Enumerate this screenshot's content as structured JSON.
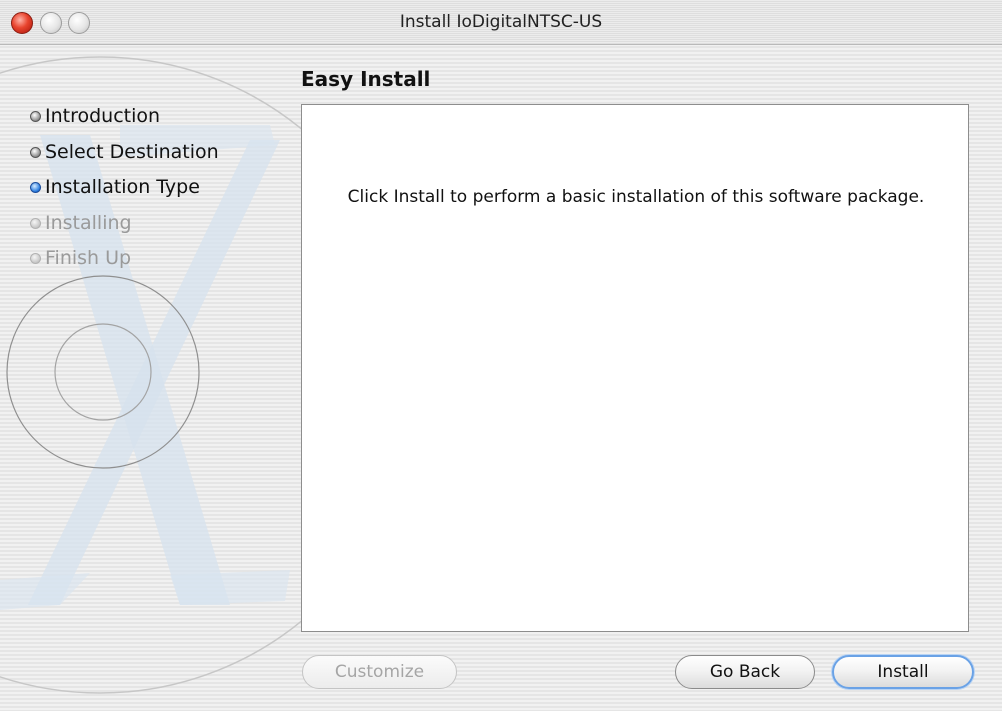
{
  "window": {
    "title": "Install IoDigitalNTSC-US"
  },
  "sidebar": {
    "steps": [
      {
        "label": "Introduction",
        "state": "done"
      },
      {
        "label": "Select Destination",
        "state": "done"
      },
      {
        "label": "Installation Type",
        "state": "current"
      },
      {
        "label": "Installing",
        "state": "future"
      },
      {
        "label": "Finish Up",
        "state": "future"
      }
    ]
  },
  "main": {
    "heading": "Easy Install",
    "body": "Click Install to perform a basic installation of this software package."
  },
  "buttons": {
    "customize": "Customize",
    "go_back": "Go Back",
    "install": "Install"
  },
  "colors": {
    "close_button": "#e8442e",
    "current_step": "#2d7fe0",
    "default_button_glow": "#6aa2e6"
  }
}
